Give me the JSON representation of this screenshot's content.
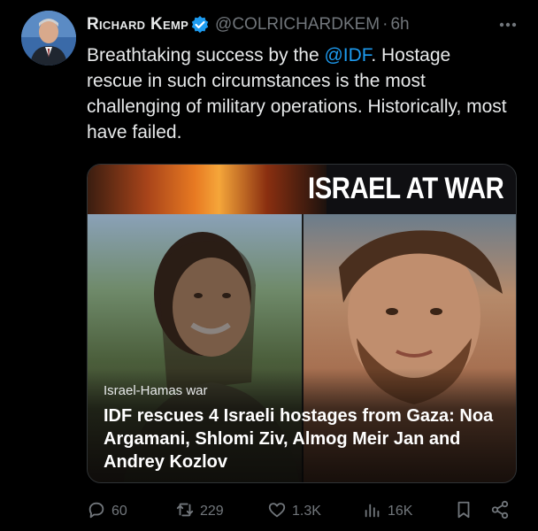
{
  "author": {
    "display_name": "Richard Kemp",
    "handle": "@COLRICHARDKEM",
    "time": "6h",
    "dot": "·"
  },
  "tweet": {
    "text_before": "Breathtaking success by the ",
    "mention": "@IDF",
    "text_after": ". Hostage rescue in such circumstances is the most challenging of military operations. Historically, most have failed."
  },
  "card": {
    "banner_title": "ISRAEL AT WAR",
    "section": "Israel-Hamas war",
    "title": "IDF rescues 4 Israeli hostages from Gaza: Noa Argamani, Shlomi Ziv, Almog Meir Jan and Andrey Kozlov"
  },
  "actions": {
    "replies": "60",
    "reposts": "229",
    "likes": "1.3K",
    "views": "16K"
  },
  "colors": {
    "background": "#000000",
    "text": "#e7e9ea",
    "muted": "#71767b",
    "accent": "#1d9bf0"
  },
  "icons": [
    "verified-badge-icon",
    "more-icon",
    "reply-icon",
    "repost-icon",
    "like-icon",
    "views-icon",
    "bookmark-icon",
    "share-icon"
  ]
}
